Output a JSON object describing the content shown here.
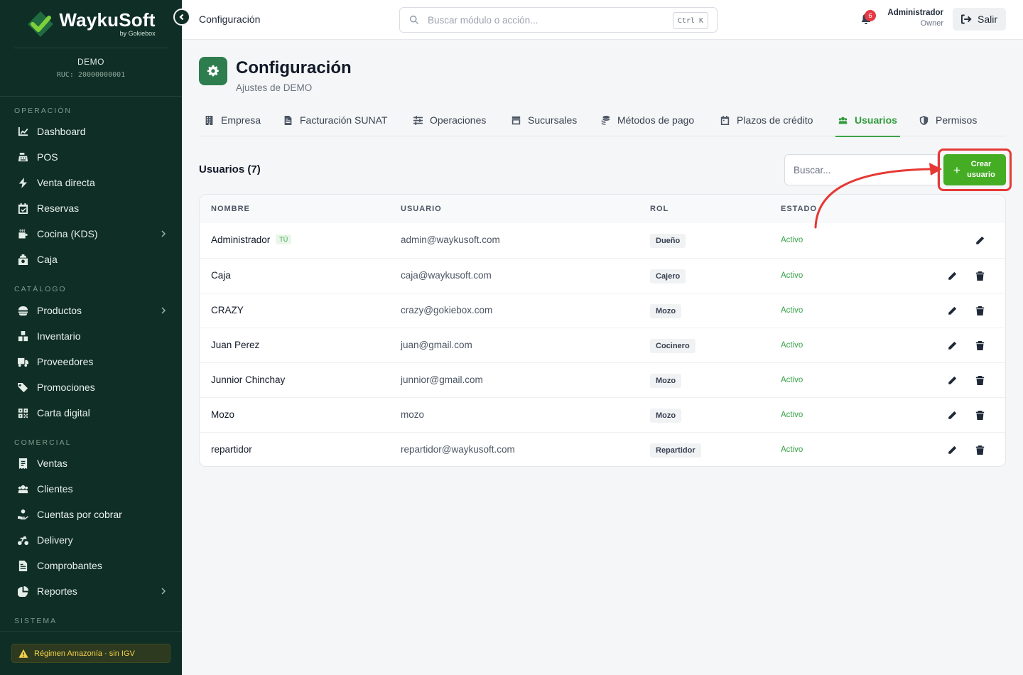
{
  "brand": {
    "name": "WaykuSoft",
    "by": "by Gokiebox"
  },
  "company": {
    "name": "DEMO",
    "ruc": "RUC: 20000000001"
  },
  "sidebar": {
    "sections": [
      {
        "title": "OPERACIÓN",
        "items": [
          {
            "label": "Dashboard",
            "icon": "chart-line-icon"
          },
          {
            "label": "POS",
            "icon": "cash-register-icon"
          },
          {
            "label": "Venta directa",
            "icon": "bolt-icon"
          },
          {
            "label": "Reservas",
            "icon": "calendar-check-icon"
          },
          {
            "label": "Cocina (KDS)",
            "icon": "kitchen-icon",
            "expandable": true
          },
          {
            "label": "Caja",
            "icon": "cash-box-icon"
          }
        ]
      },
      {
        "title": "CATÁLOGO",
        "items": [
          {
            "label": "Productos",
            "icon": "burger-icon",
            "expandable": true
          },
          {
            "label": "Inventario",
            "icon": "boxes-icon"
          },
          {
            "label": "Proveedores",
            "icon": "truck-icon"
          },
          {
            "label": "Promociones",
            "icon": "tags-icon"
          },
          {
            "label": "Carta digital",
            "icon": "qrcode-icon"
          }
        ]
      },
      {
        "title": "COMERCIAL",
        "items": [
          {
            "label": "Ventas",
            "icon": "receipt-icon"
          },
          {
            "label": "Clientes",
            "icon": "users-icon"
          },
          {
            "label": "Cuentas por cobrar",
            "icon": "hand-coin-icon"
          },
          {
            "label": "Delivery",
            "icon": "motorcycle-icon"
          },
          {
            "label": "Comprobantes",
            "icon": "file-invoice-icon"
          },
          {
            "label": "Reportes",
            "icon": "pie-chart-icon",
            "expandable": true
          }
        ]
      },
      {
        "title": "SISTEMA",
        "items": []
      }
    ],
    "regime": "Régimen Amazonía · sin IGV"
  },
  "topbar": {
    "breadcrumb": "Configuración",
    "search_placeholder": "Buscar módulo o acción...",
    "shortcut": "Ctrl K",
    "notifications": "6",
    "user_name": "Administrador",
    "user_role": "Owner",
    "logout": "Salir"
  },
  "page": {
    "title": "Configuración",
    "subtitle": "Ajustes de DEMO",
    "tabs": [
      {
        "label": "Empresa",
        "icon": "building-icon",
        "active": false
      },
      {
        "label": "Facturación SUNAT",
        "icon": "file-invoice-icon",
        "active": false
      },
      {
        "label": "Operaciones",
        "icon": "sliders-icon",
        "active": false
      },
      {
        "label": "Sucursales",
        "icon": "store-icon",
        "active": false
      },
      {
        "label": "Métodos de pago",
        "icon": "coins-icon",
        "active": false
      },
      {
        "label": "Plazos de crédito",
        "icon": "calendar-icon",
        "active": false
      },
      {
        "label": "Usuarios",
        "icon": "users-icon",
        "active": true
      },
      {
        "label": "Permisos",
        "icon": "shield-icon",
        "active": false
      }
    ]
  },
  "users": {
    "heading": "Usuarios (7)",
    "search_placeholder": "Buscar...",
    "create_label": "Crear usuario",
    "columns": [
      "NOMBRE",
      "USUARIO",
      "ROL",
      "ESTADO"
    ],
    "you_badge": "TÚ",
    "rows": [
      {
        "name": "Administrador",
        "user": "admin@waykusoft.com",
        "role": "Dueño",
        "status": "Activo",
        "is_self": true
      },
      {
        "name": "Caja",
        "user": "caja@waykusoft.com",
        "role": "Cajero",
        "status": "Activo"
      },
      {
        "name": "CRAZY",
        "user": "crazy@gokiebox.com",
        "role": "Mozo",
        "status": "Activo"
      },
      {
        "name": "Juan Perez",
        "user": "juan@gmail.com",
        "role": "Cocinero",
        "status": "Activo"
      },
      {
        "name": "Junnior Chinchay",
        "user": "junnior@gmail.com",
        "role": "Mozo",
        "status": "Activo"
      },
      {
        "name": "Mozo",
        "user": "mozo",
        "role": "Mozo",
        "status": "Activo"
      },
      {
        "name": "repartidor",
        "user": "repartidor@waykusoft.com",
        "role": "Repartidor",
        "status": "Activo"
      }
    ]
  },
  "colors": {
    "sidebar": "#0f2e25",
    "accent": "#3aa34a",
    "create_button": "#45ad24",
    "highlight": "#e53935"
  }
}
